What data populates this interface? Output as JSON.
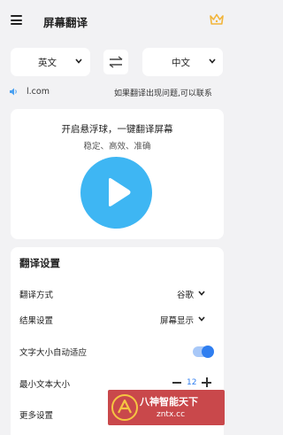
{
  "header": {
    "title": "屏幕翻译",
    "menu_icon": "menu-icon",
    "vip_icon": "crown-icon",
    "accent": "#f2b53a"
  },
  "language_bar": {
    "source": "英文",
    "target": "中文",
    "swap_icon": "swap-icon"
  },
  "notice": {
    "icon": "speaker-icon",
    "left_text": "l.com",
    "right_text": "如果翻译出现问题,可以联系"
  },
  "promo": {
    "title": "开启悬浮球，一键翻译屏幕",
    "subtitle": "稳定、高效、准确",
    "play_color": "#3eb6f3"
  },
  "settings": {
    "title": "翻译设置",
    "rows": [
      {
        "label": "翻译方式",
        "value": "谷歌"
      },
      {
        "label": "结果设置",
        "value": "屏幕显示"
      },
      {
        "label": "文字大小自动适应",
        "toggle": true
      },
      {
        "label": "最小文本大小",
        "stepper_value": "12"
      },
      {
        "label": "更多设置"
      }
    ],
    "toggle_color": "#2f7ef0"
  },
  "watermark": {
    "text": "八神智能天下",
    "url": "zntx.cc"
  }
}
